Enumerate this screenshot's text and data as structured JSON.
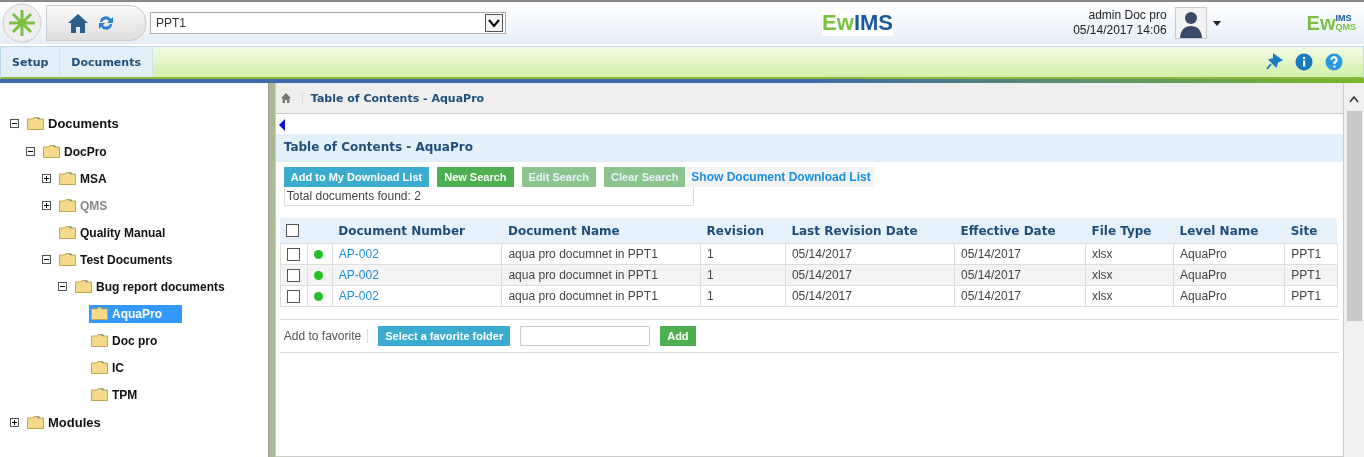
{
  "header": {
    "site_select": {
      "value": "PPT1"
    },
    "center_logo": {
      "text": "EwIMS"
    },
    "user": {
      "name": "admin Doc pro",
      "datetime": "05/14/2017 14:06"
    },
    "right_logo": {
      "main": "Ew",
      "sub_top": "IMS",
      "sub_bottom": "QMS"
    }
  },
  "nav_tabs": [
    {
      "label": "Setup",
      "selected": false
    },
    {
      "label": "Documents",
      "selected": false
    }
  ],
  "tree": [
    {
      "label": "Documents",
      "expanded": true,
      "selected": false,
      "disabled": false,
      "children": [
        {
          "label": "DocPro",
          "expanded": true,
          "selected": false,
          "disabled": false,
          "children": [
            {
              "label": "MSA",
              "expanded": false,
              "selected": false,
              "disabled": false
            },
            {
              "label": "QMS",
              "expanded": false,
              "selected": false,
              "disabled": true
            },
            {
              "label": "Quality Manual",
              "selected": false,
              "disabled": false
            },
            {
              "label": "Test Documents",
              "expanded": true,
              "selected": false,
              "disabled": false,
              "children": [
                {
                  "label": "Bug report documents",
                  "expanded": true,
                  "selected": false,
                  "disabled": false,
                  "children": [
                    {
                      "label": "AquaPro",
                      "selected": true,
                      "disabled": false
                    },
                    {
                      "label": "Doc pro",
                      "selected": false,
                      "disabled": false
                    },
                    {
                      "label": "IC",
                      "selected": false,
                      "disabled": false
                    },
                    {
                      "label": "TPM",
                      "selected": false,
                      "disabled": false
                    }
                  ]
                }
              ]
            }
          ]
        }
      ]
    },
    {
      "label": "Modules",
      "expanded": false,
      "selected": false,
      "disabled": false
    }
  ],
  "breadcrumb": "Table of Contents - AquaPro",
  "panel_title": "Table of Contents - AquaPro",
  "actions": [
    {
      "label": "Add to My Download List",
      "kind": "info",
      "disabled": false
    },
    {
      "label": "New Search",
      "kind": "success",
      "disabled": false
    },
    {
      "label": "Edit Search",
      "kind": "success",
      "disabled": true
    },
    {
      "label": "Clear Search",
      "kind": "success",
      "disabled": true
    },
    {
      "label": "Show Document Download List",
      "kind": "link"
    }
  ],
  "total": "Total documents found: 2",
  "table": {
    "header_checked": false,
    "columns": [
      "Document Number",
      "Document Name",
      "Revision",
      "Last Revision Date",
      "Effective Date",
      "File Type",
      "Level Name",
      "Site"
    ],
    "rows": [
      {
        "checked": false,
        "color": "#22c022",
        "cells": [
          "AP-002",
          "aqua pro documnet in PPT1",
          "1",
          "05/14/2017",
          "05/14/2017",
          "xlsx",
          "AquaPro",
          "PPT1"
        ]
      },
      {
        "checked": false,
        "color": "#22c022",
        "cells": [
          "AP-002",
          "aqua pro documnet in PPT1",
          "1",
          "05/14/2017",
          "05/14/2017",
          "xlsx",
          "AquaPro",
          "PPT1"
        ]
      },
      {
        "checked": false,
        "color": "#22c022",
        "cells": [
          "AP-002",
          "aqua pro documnet in PPT1",
          "1",
          "05/14/2017",
          "05/14/2017",
          "xlsx",
          "AquaPro",
          "PPT1"
        ]
      }
    ]
  },
  "favorite": {
    "label": "Add to favorite",
    "select_button": "Select a favorite folder",
    "add_button": "Add"
  }
}
